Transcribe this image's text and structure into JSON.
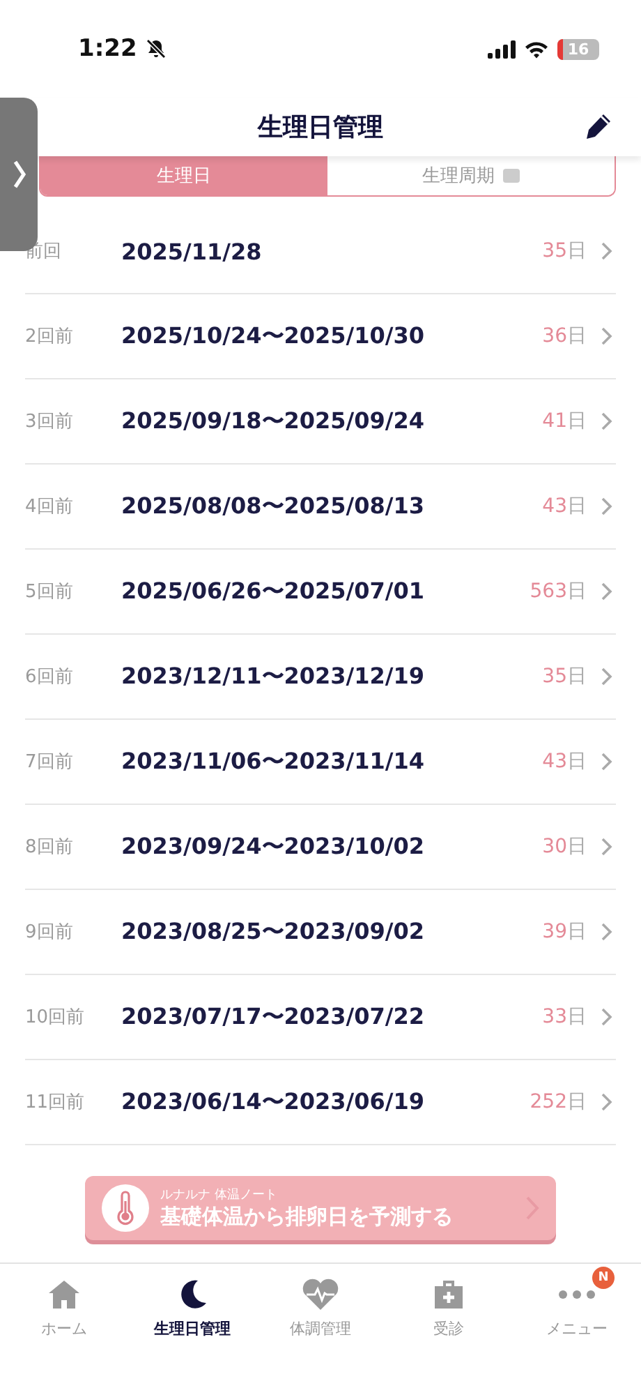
{
  "status_bar": {
    "time": "1:22",
    "battery": "16"
  },
  "header": {
    "title": "生理日管理"
  },
  "segments": [
    {
      "label": "生理日",
      "selected": true,
      "locked": false
    },
    {
      "label": "生理周期",
      "selected": false,
      "locked": true
    }
  ],
  "periods": [
    {
      "label": "前回",
      "dates": "2025/11/28",
      "days": "35",
      "unit": "日"
    },
    {
      "label": "2回前",
      "dates": "2025/10/24〜2025/10/30",
      "days": "36",
      "unit": "日"
    },
    {
      "label": "3回前",
      "dates": "2025/09/18〜2025/09/24",
      "days": "41",
      "unit": "日"
    },
    {
      "label": "4回前",
      "dates": "2025/08/08〜2025/08/13",
      "days": "43",
      "unit": "日"
    },
    {
      "label": "5回前",
      "dates": "2025/06/26〜2025/07/01",
      "days": "563",
      "unit": "日"
    },
    {
      "label": "6回前",
      "dates": "2023/12/11〜2023/12/19",
      "days": "35",
      "unit": "日"
    },
    {
      "label": "7回前",
      "dates": "2023/11/06〜2023/11/14",
      "days": "43",
      "unit": "日"
    },
    {
      "label": "8回前",
      "dates": "2023/09/24〜2023/10/02",
      "days": "30",
      "unit": "日"
    },
    {
      "label": "9回前",
      "dates": "2023/08/25〜2023/09/02",
      "days": "39",
      "unit": "日"
    },
    {
      "label": "10回前",
      "dates": "2023/07/17〜2023/07/22",
      "days": "33",
      "unit": "日"
    },
    {
      "label": "11回前",
      "dates": "2023/06/14〜2023/06/19",
      "days": "252",
      "unit": "日"
    }
  ],
  "banner": {
    "subtitle": "ルナルナ 体温ノート",
    "title": "基礎体温から排卵日を予測する"
  },
  "tab_bar": [
    {
      "label": "ホーム",
      "selected": false
    },
    {
      "label": "生理日管理",
      "selected": true
    },
    {
      "label": "体調管理",
      "selected": false
    },
    {
      "label": "受診",
      "selected": false
    },
    {
      "label": "メニュー",
      "selected": false,
      "badge": "N"
    }
  ]
}
